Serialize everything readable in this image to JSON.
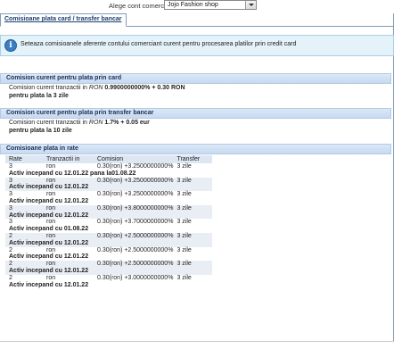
{
  "topbar": {
    "merchant_label": "Alege cont comerciant:",
    "merchant_value": "Jojo Fashion shop"
  },
  "tabs": [
    {
      "label": "Comisioane plata card / transfer bancar"
    }
  ],
  "info": {
    "icon": "info-icon",
    "text": "Seteaza comisioanele aferente contului comerciant curent pentru procesarea platilor prin credit card"
  },
  "card_section": {
    "title": "Comision curent pentru plata prin card",
    "line1_prefix": "Comision curent tranzactii in",
    "line1_currency": "RON",
    "line1_value": "0.9900000000% + 0.30 RON",
    "line2": "pentru plata la 3 zile"
  },
  "transfer_section": {
    "title": "Comision curent pentru plata prin transfer bancar",
    "line1_prefix": "Comision curent tranzactii in",
    "line1_currency": "RON",
    "line1_value": "1.7% + 0.05 eur",
    "line2": "pentru plata la 10 zile"
  },
  "rates_section": {
    "title": "Comisioane plata in rate",
    "headers": [
      "Rate",
      "Tranzactii in",
      "Comision",
      "Transfer"
    ],
    "rows": [
      {
        "rate": "3",
        "currency": "ron",
        "commission": "0.30(ron) +3.2500000000%",
        "transfer": "3 zile",
        "active": "Activ incepand cu 12.01.22 pana la01.08.22"
      },
      {
        "rate": "3",
        "currency": "ron",
        "commission": "0.30(ron) +3.2500000000%",
        "transfer": "3 zile",
        "active": "Activ incepand cu 12.01.22"
      },
      {
        "rate": "3",
        "currency": "ron",
        "commission": "0.30(ron) +3.2500000000%",
        "transfer": "3 zile",
        "active": "Activ incepand cu 12.01.22"
      },
      {
        "rate": "3",
        "currency": "ron",
        "commission": "0.30(ron) +3.8000000000%",
        "transfer": "3 zile",
        "active": "Activ incepand cu 12.01.22"
      },
      {
        "rate": "3",
        "currency": "ron",
        "commission": "0.30(ron) +3.7000000000%",
        "transfer": "3 zile",
        "active": "Activ incepand cu 01.08.22"
      },
      {
        "rate": "2",
        "currency": "ron",
        "commission": "0.30(ron) +2.5000000000%",
        "transfer": "3 zile",
        "active": "Activ incepand cu 12.01.22"
      },
      {
        "rate": "2",
        "currency": "ron",
        "commission": "0.30(ron) +2.5000000000%",
        "transfer": "3 zile",
        "active": "Activ incepand cu 12.01.22"
      },
      {
        "rate": "2",
        "currency": "ron",
        "commission": "0.30(ron) +2.5000000000%",
        "transfer": "3 zile",
        "active": "Activ incepand cu 12.01.22"
      },
      {
        "rate": "2",
        "currency": "ron",
        "commission": "0.30(ron) +3.0000000000%",
        "transfer": "3 zile",
        "active": "Activ incepand cu 12.01.22"
      }
    ]
  }
}
